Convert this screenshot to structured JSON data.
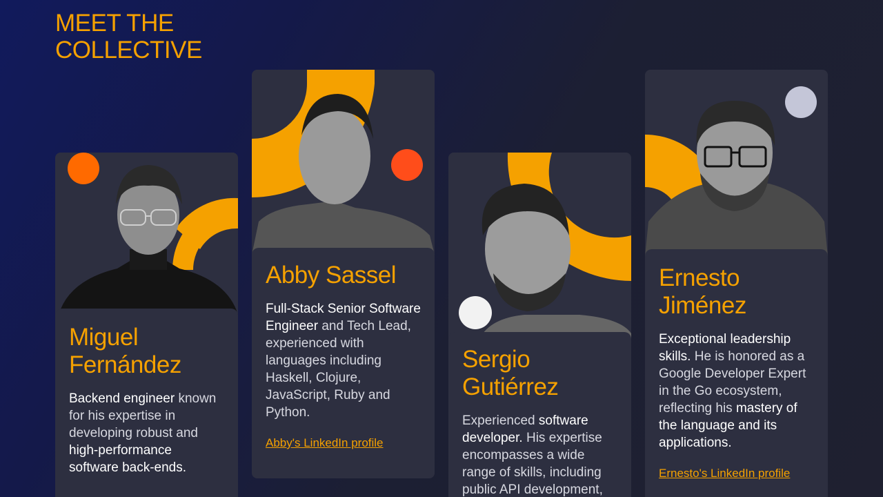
{
  "page": {
    "heading_line1": "MEET THE",
    "heading_line2": "COLLECTIVE"
  },
  "colors": {
    "accent": "#f5a100",
    "card_bg": "#2d2f40",
    "orange_dot": "#ff6a00",
    "red_orange_dot": "#ff4d1a",
    "white_dot": "#f2f2f2",
    "grey_dot": "#c4c6d8"
  },
  "members": [
    {
      "name_line1": "Miguel",
      "name_line2": "Fernández",
      "desc": {
        "p1": "Backend engineer",
        "p2": " known for his expertise in developing robust and ",
        "p3": "high-performance software back-ends."
      }
    },
    {
      "name_line1": "Abby Sassel",
      "desc": {
        "p1": "Full-Stack Senior Software Engineer",
        "p2": " and Tech Lead, experienced with languages including Haskell, Clojure, JavaScript, Ruby and Python."
      },
      "link": "Abby's LinkedIn profile"
    },
    {
      "name_line1": "Sergio",
      "name_line2": "Gutiérrez",
      "desc": {
        "p1": "Experienced ",
        "p2": "software developer.",
        "p3": " His expertise encompasses a wide range of skills, including public API development,"
      }
    },
    {
      "name_line1": "Ernesto",
      "name_line2": "Jiménez",
      "desc": {
        "p1": "Exceptional leadership skills.",
        "p2": " He is honored as a Google Developer Expert in the Go ecosystem, reflecting his ",
        "p3": "mastery of the language and its applications."
      },
      "link": "Ernesto's LinkedIn profile"
    }
  ]
}
